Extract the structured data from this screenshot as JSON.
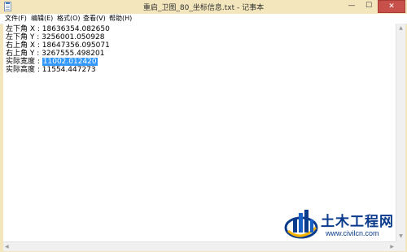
{
  "window": {
    "title": "重启_卫图_80_坐标信息.txt - 记事本",
    "minimize_glyph": "—",
    "maximize_glyph": "☐",
    "close_glyph": "✕"
  },
  "menu": {
    "items": [
      {
        "label": "文件(F)"
      },
      {
        "label": "编辑(E)"
      },
      {
        "label": "格式(O)"
      },
      {
        "label": "查看(V)"
      },
      {
        "label": "帮助(H)"
      }
    ]
  },
  "document": {
    "lines": [
      {
        "key": "左下角 X",
        "value": "18636354.082650"
      },
      {
        "key": "左下角 Y",
        "value": "3256001.050928"
      },
      {
        "key": "右上角 X",
        "value": "18647356.095071"
      },
      {
        "key": "右上角 Y",
        "value": "3267555.498201"
      },
      {
        "key": "实际宽度",
        "value": "11002.012420"
      },
      {
        "key": "实际高度",
        "value": "11554.447273"
      }
    ],
    "separator": " : ",
    "selected_line_index": 4
  },
  "watermark": {
    "title": "土木工程网",
    "url": "www.civilcn.com",
    "colors": {
      "primary": "#0a3a8c",
      "accent": "#f5b400"
    }
  },
  "scrollbar": {
    "up": "▲",
    "down": "▼",
    "left": "◀",
    "right": "▶"
  }
}
